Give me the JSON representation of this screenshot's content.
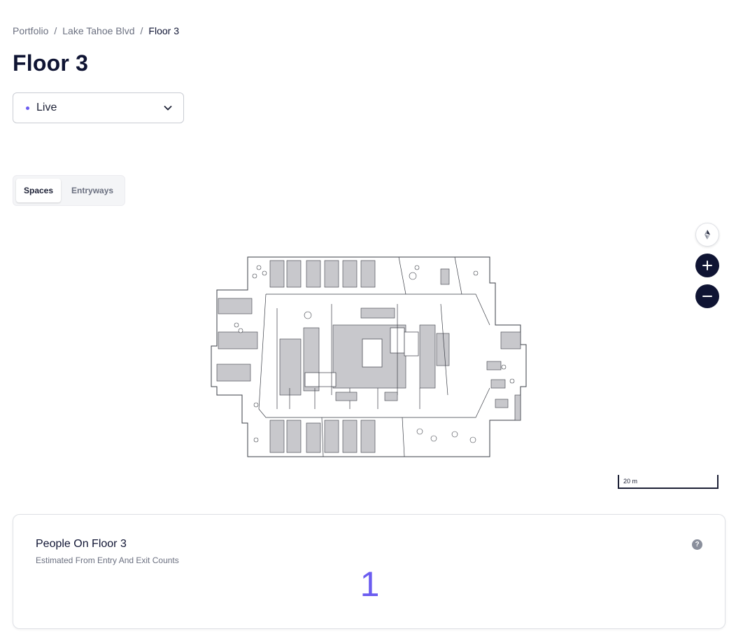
{
  "breadcrumb": {
    "items": [
      "Portfolio",
      "Lake Tahoe Blvd"
    ],
    "current": "Floor 3",
    "separator": "/"
  },
  "page_title": "Floor 3",
  "mode_select": {
    "value": "Live",
    "dot_color": "#6b5cf0",
    "icon": "chevron-down-icon"
  },
  "tabs": [
    {
      "label": "Spaces",
      "active": true
    },
    {
      "label": "Entryways",
      "active": false
    }
  ],
  "map": {
    "controls": [
      "compass-icon",
      "zoom-in-icon",
      "zoom-out-icon"
    ],
    "scale_label": "20 m"
  },
  "occupancy_card": {
    "title": "People On Floor 3",
    "subtitle": "Estimated From Entry And Exit Counts",
    "value": "1",
    "value_color": "#6b5cf0",
    "help_icon": "?"
  }
}
